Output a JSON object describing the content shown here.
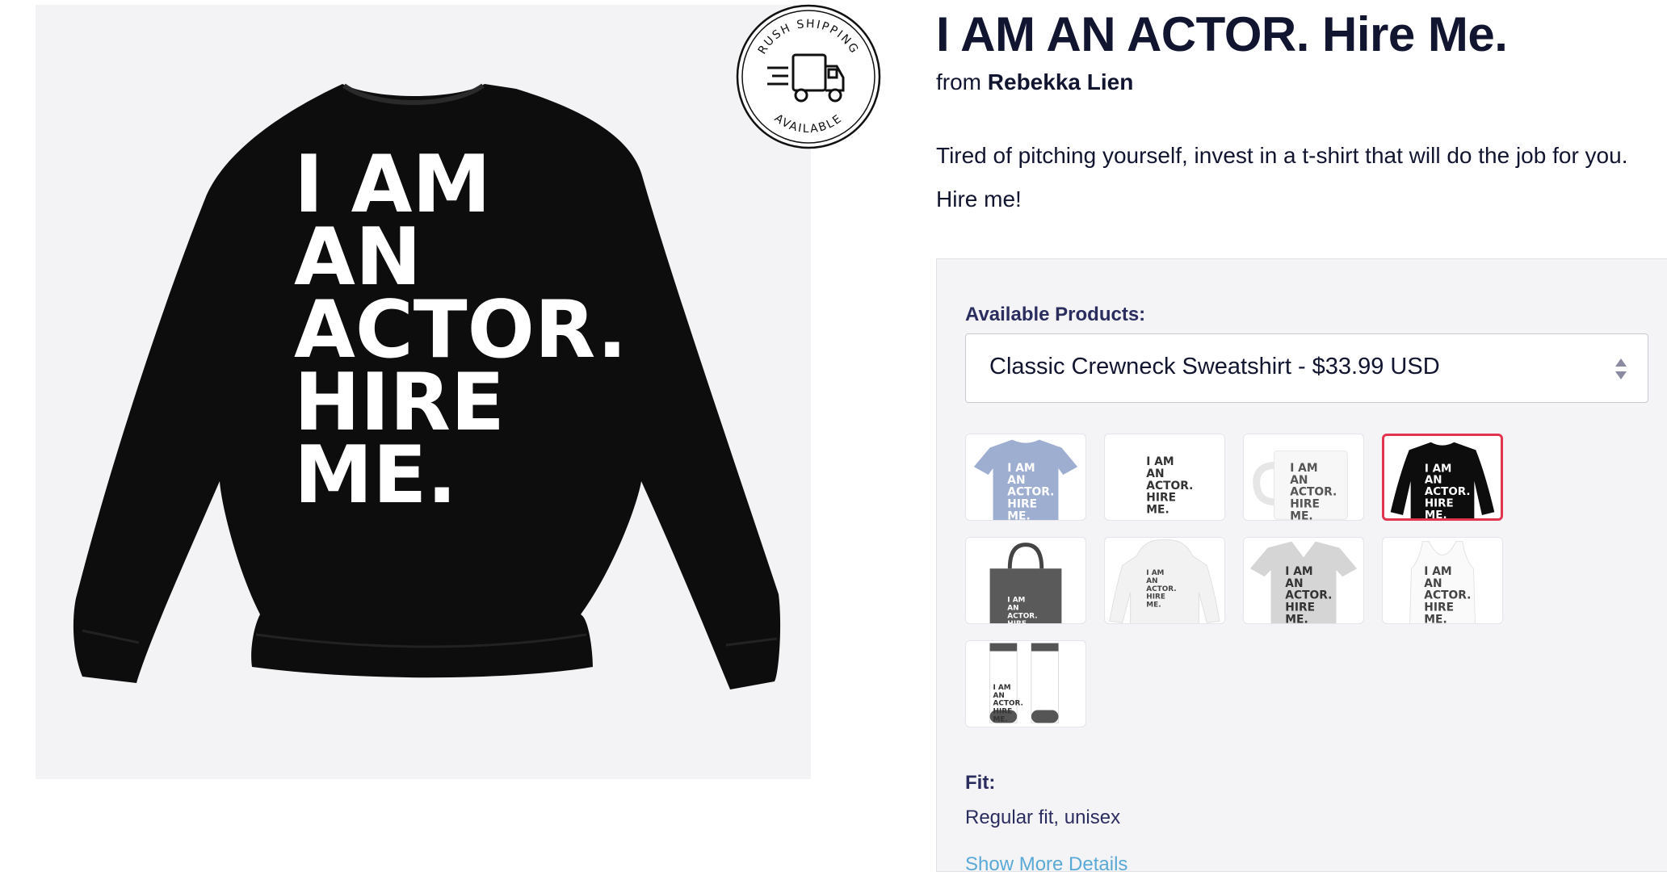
{
  "product": {
    "title": "I AM AN ACTOR. Hire Me.",
    "byline_prefix": "from",
    "seller": "Rebekka Lien",
    "description": "Tired of pitching yourself, invest in a t-shirt that will do the job for you. Hire me!"
  },
  "main_image": {
    "design_lines": [
      "I AM",
      "AN",
      "ACTOR.",
      "HIRE",
      "ME."
    ],
    "garment_color": "#0d0d0d",
    "print_color": "#ffffff"
  },
  "badge": {
    "top_text": "RUSH SHIPPING",
    "bottom_text": "AVAILABLE",
    "icon": "truck-icon"
  },
  "selector": {
    "label": "Available Products:",
    "selected_value": "Classic Crewneck Sweatshirt - $33.99 USD",
    "icon": "select-arrows-icon"
  },
  "thumbnails": [
    {
      "name": "thumb-tshirt",
      "kind": "tshirt",
      "color": "#9eaed0",
      "print": "#ffffff",
      "selected": false
    },
    {
      "name": "thumb-sticker",
      "kind": "sticker",
      "color": "#ffffff",
      "print": "#333333",
      "selected": false
    },
    {
      "name": "thumb-mug",
      "kind": "mug",
      "color": "#f7f7f7",
      "print": "#555555",
      "selected": false
    },
    {
      "name": "thumb-sweatshirt",
      "kind": "sweatshirt",
      "color": "#0d0d0d",
      "print": "#ffffff",
      "selected": true
    },
    {
      "name": "thumb-tote",
      "kind": "tote",
      "color": "#5a5a5a",
      "print": "#ffffff",
      "selected": false
    },
    {
      "name": "thumb-hoodie",
      "kind": "hoodie",
      "color": "#f2f2f2",
      "print": "#444444",
      "selected": false
    },
    {
      "name": "thumb-vneck",
      "kind": "vneck",
      "color": "#d5d5d5",
      "print": "#333333",
      "selected": false
    },
    {
      "name": "thumb-tank",
      "kind": "tank",
      "color": "#fafafa",
      "print": "#444444",
      "selected": false
    },
    {
      "name": "thumb-socks",
      "kind": "socks",
      "color": "#ffffff",
      "print": "#333333",
      "selected": false
    }
  ],
  "thumb_design_lines": [
    "I AM",
    "AN",
    "ACTOR.",
    "HIRE",
    "ME."
  ],
  "fit": {
    "label": "Fit:",
    "value": "Regular fit, unisex"
  },
  "details_link": "Show More Details",
  "colors": {
    "accent_selected": "#e3344f",
    "heading": "#111530",
    "label": "#2a2d5e",
    "link": "#5aa9d6"
  }
}
